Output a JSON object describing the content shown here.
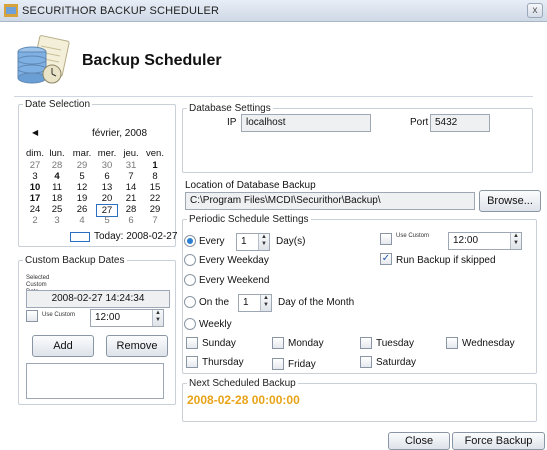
{
  "window": {
    "title": "SECURITHOR BACKUP SCHEDULER",
    "close_glyph": "x"
  },
  "header": {
    "title": "Backup Scheduler",
    "logo_icon": "database-schedule-icon"
  },
  "date_selection": {
    "legend": "Date Selection",
    "month_label": "février, 2008",
    "prev_glyph": "◀",
    "weekdays": [
      "dim.",
      "lun.",
      "mar.",
      "mer.",
      "jeu.",
      "ven."
    ],
    "weeks": [
      [
        "27",
        "28",
        "29",
        "30",
        "31",
        "1"
      ],
      [
        "3",
        "4",
        "5",
        "6",
        "7",
        "8"
      ],
      [
        "10",
        "11",
        "12",
        "13",
        "14",
        "15"
      ],
      [
        "17",
        "18",
        "19",
        "20",
        "21",
        "22"
      ],
      [
        "24",
        "25",
        "26",
        "27",
        "28",
        "29"
      ],
      [
        "2",
        "3",
        "4",
        "5",
        "6",
        "7"
      ]
    ],
    "selected_day": "27",
    "today_label": "Today: 2008-02-27"
  },
  "custom_backup": {
    "legend": "Custom Backup Dates",
    "selected_label": "Selected Custom Date",
    "datetime_value": "2008-02-27 14:24:34",
    "use_custom_label": "Use Custom",
    "time_value": "12:00",
    "add_label": "Add",
    "remove_label": "Remove"
  },
  "database_settings": {
    "legend": "Database Settings",
    "ip_label": "IP",
    "ip_value": "localhost",
    "port_label": "Port",
    "port_value": "5432"
  },
  "location": {
    "label": "Location of Database Backup",
    "path": "C:\\Program Files\\MCDI\\Securithor\\Backup\\",
    "browse_label": "Browse..."
  },
  "periodic": {
    "legend": "Periodic Schedule Settings",
    "every_label": "Every",
    "every_value": "1",
    "days_label": "Day(s)",
    "use_custom_label": "Use Custom",
    "time_value": "12:00",
    "every_weekday_label": "Every Weekday",
    "run_if_skipped_label": "Run Backup if skipped",
    "every_weekend_label": "Every Weekend",
    "on_the_label": "On the",
    "on_the_value": "1",
    "day_of_month_label": "Day of the Month",
    "weekly_label": "Weekly",
    "days": [
      "Sunday",
      "Monday",
      "Tuesday",
      "Wednesday",
      "Thursday",
      "Friday",
      "Saturday"
    ]
  },
  "next_backup": {
    "legend": "Next Scheduled Backup",
    "value": "2008-02-28 00:00:00",
    "value_color": "#e8a317"
  },
  "footer": {
    "close_label": "Close",
    "force_label": "Force Backup Now"
  }
}
